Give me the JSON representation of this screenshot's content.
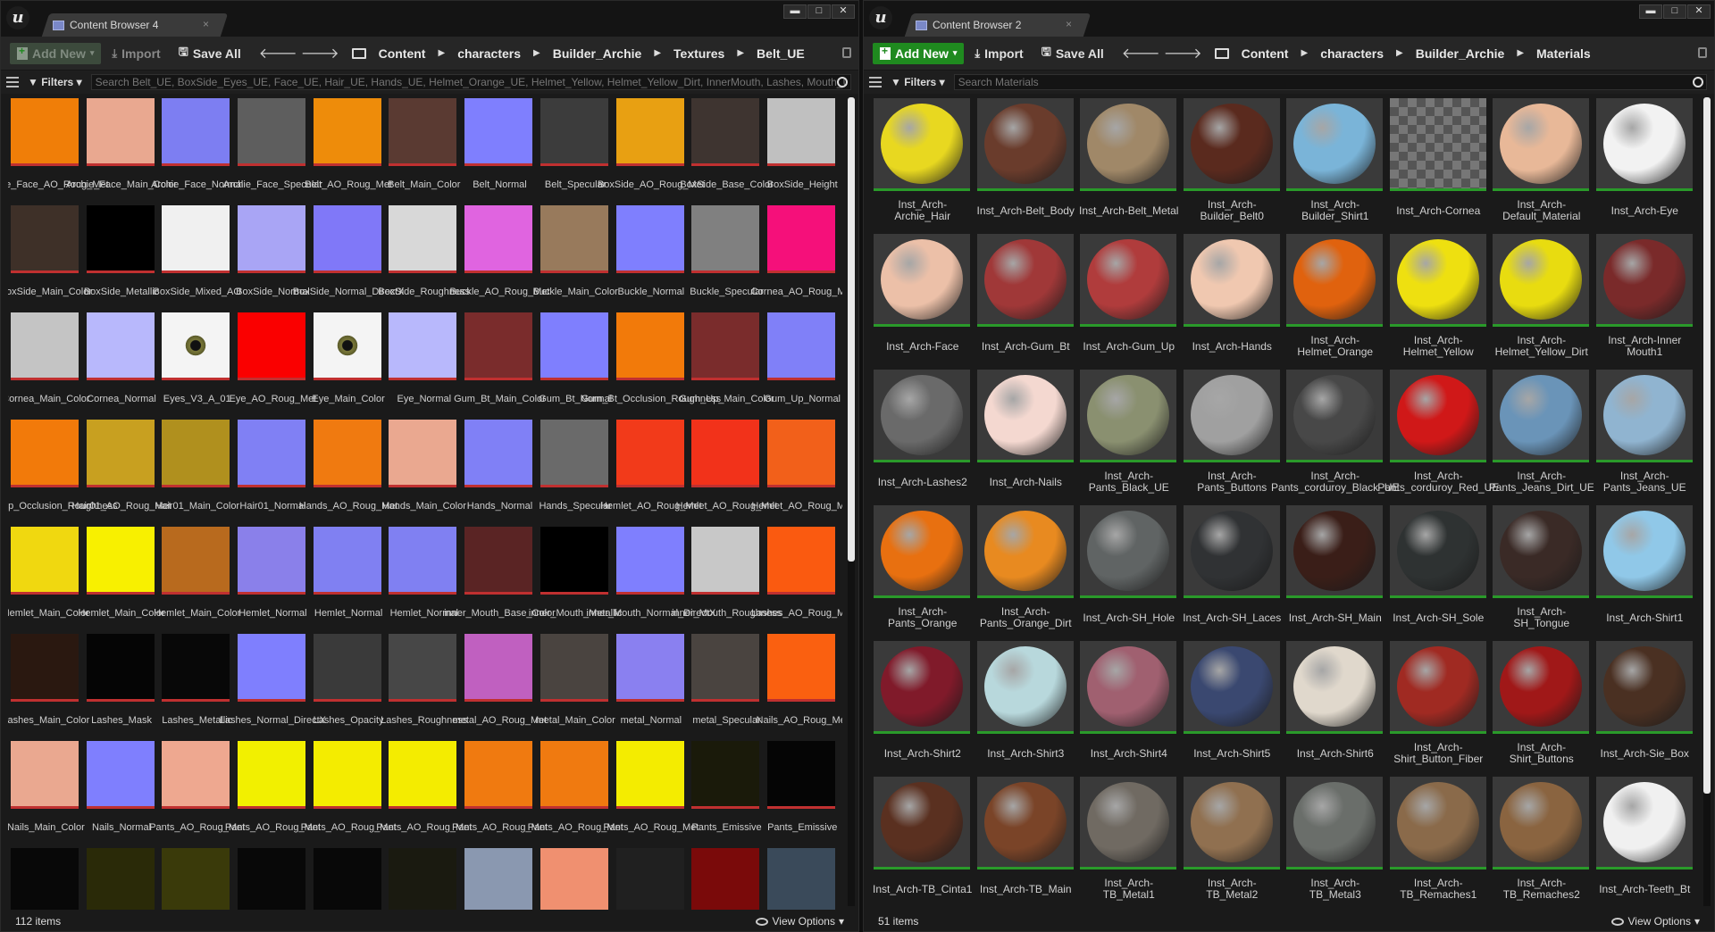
{
  "left": {
    "tab_title": "Content Browser 4",
    "toolbar": {
      "add_new": "Add New",
      "import": "Import",
      "save_all": "Save All"
    },
    "breadcrumb": [
      "Content",
      "characters",
      "Builder_Archie",
      "Textures",
      "Belt_UE"
    ],
    "filters_label": "Filters",
    "search_placeholder": "Search Belt_UE, BoxSide_Eyes_UE, Face_UE, Hair_UE, Hands_UE, Helmet_Orange_UE, Helmet_Yellow, Helmet_Yellow_Dirt, InnerMouth, Lashes, Mouth_UE",
    "item_count": "112 items",
    "view_options": "View Options",
    "assets": [
      {
        "label": "Archie_Face_AO_Roug_Met",
        "color": "#f07e08"
      },
      {
        "label": "Archie_Face_Main_Color",
        "color": "#e9a890"
      },
      {
        "label": "Archie_Face_Normal",
        "color": "#7d7ef2"
      },
      {
        "label": "Archie_Face_Specular",
        "color": "#5e5e5e"
      },
      {
        "label": "Belt_AO_Roug_Met",
        "color": "#ee8c0a"
      },
      {
        "label": "Belt_Main_Color",
        "color": "#5a3a32"
      },
      {
        "label": "Belt_Normal",
        "color": "#7f7ffe"
      },
      {
        "label": "Belt_Specular",
        "color": "#3c3c3c"
      },
      {
        "label": "BoxSide_AO_Roug_Met",
        "color": "#e8a012"
      },
      {
        "label": "BoxSide_Base_Color",
        "color": "#3e3430"
      },
      {
        "label": "BoxSide_Height",
        "color": "#c0c0c0"
      },
      {
        "label": "BoxSide_Main_Color",
        "color": "#3e3028"
      },
      {
        "label": "BoxSide_Metallic",
        "color": "#000000"
      },
      {
        "label": "BoxSide_Mixed_AO",
        "color": "#f0f0f0"
      },
      {
        "label": "BoxSide_Normal",
        "color": "#a9a5f5"
      },
      {
        "label": "BoxSide_Normal_DirectX",
        "color": "#8078f8"
      },
      {
        "label": "BoxSide_Roughness",
        "color": "#d8d8d8"
      },
      {
        "label": "Buckle_AO_Roug_Met",
        "color": "#e064e0"
      },
      {
        "label": "Buckle_Main_Color",
        "color": "#987a5c"
      },
      {
        "label": "Buckle_Normal",
        "color": "#7f7ffe"
      },
      {
        "label": "Buckle_Specular",
        "color": "#808080"
      },
      {
        "label": "Cornea_AO_Roug_Met",
        "color": "#f5107a"
      },
      {
        "label": "Cornea_Main_Color",
        "color": "#c4c4c4"
      },
      {
        "label": "Cornea_Normal",
        "color": "#b8b8fc"
      },
      {
        "label": "Eyes_V3_A_01",
        "color": "#f4f4f4",
        "eye": true
      },
      {
        "label": "Eye_AO_Roug_Met",
        "color": "#fa0000"
      },
      {
        "label": "Eye_Main_Color",
        "color": "#f4f4f4",
        "eye": true
      },
      {
        "label": "Eye_Normal",
        "color": "#b8b8fc"
      },
      {
        "label": "Gum_Bt_Main_Color",
        "color": "#7a2c2c"
      },
      {
        "label": "Gum_Bt_Normal",
        "color": "#7f7ffe"
      },
      {
        "label": "Gum_Bt_Occlusion_Roughness",
        "color": "#f27a0a"
      },
      {
        "label": "Gum_Up_Main_Color",
        "color": "#7a2c2c"
      },
      {
        "label": "Gum_Up_Normal",
        "color": "#8080f8"
      },
      {
        "label": "Gum_Up_Occlusion_Roughness",
        "color": "#f27a0a"
      },
      {
        "label": "Hair01_AO_Roug_Met",
        "color": "#c8a020"
      },
      {
        "label": "Hair01_Main_Color",
        "color": "#b0901e"
      },
      {
        "label": "Hair01_Normal",
        "color": "#8080f4"
      },
      {
        "label": "Hands_AO_Roug_Met",
        "color": "#f07a10"
      },
      {
        "label": "Hands_Main_Color",
        "color": "#eaa890"
      },
      {
        "label": "Hands_Normal",
        "color": "#8080f6"
      },
      {
        "label": "Hands_Specular",
        "color": "#6a6a6a"
      },
      {
        "label": "Hemlet_AO_Roug_Met",
        "color": "#f23a1a"
      },
      {
        "label": "Hemlet_AO_Roug_Met",
        "color": "#f2321a"
      },
      {
        "label": "Hemlet_AO_Roug_Met",
        "color": "#f2601a"
      },
      {
        "label": "Hemlet_Main_Color",
        "color": "#f0d810"
      },
      {
        "label": "Hemlet_Main_Color",
        "color": "#f8f000"
      },
      {
        "label": "Hemlet_Main_Color",
        "color": "#b86a1e"
      },
      {
        "label": "Hemlet_Normal",
        "color": "#8a80ea"
      },
      {
        "label": "Hemlet_Normal",
        "color": "#8080f2"
      },
      {
        "label": "Hemlet_Normal",
        "color": "#8080f2"
      },
      {
        "label": "inner_Mouth_Base_Color",
        "color": "#5a2424"
      },
      {
        "label": "inner_Mouth_Metallic",
        "color": "#000000"
      },
      {
        "label": "inner_Mouth_Normal_DirectX",
        "color": "#7f7ffe"
      },
      {
        "label": "inner_Mouth_Roughness",
        "color": "#c8c8c8"
      },
      {
        "label": "Lashes_AO_Roug_Met",
        "color": "#fa5a10"
      },
      {
        "label": "Lashes_Main_Color",
        "color": "#2a1810"
      },
      {
        "label": "Lashes_Mask",
        "color": "#050505"
      },
      {
        "label": "Lashes_Metallic",
        "color": "#080808"
      },
      {
        "label": "Lashes_Normal_DirectX",
        "color": "#7f7ffe"
      },
      {
        "label": "Lashes_Opacity",
        "color": "#3a3a3a"
      },
      {
        "label": "Lashes_Roughness",
        "color": "#474747"
      },
      {
        "label": "metal_AO_Roug_Met",
        "color": "#c060c0"
      },
      {
        "label": "metal_Main_Color",
        "color": "#4a4440"
      },
      {
        "label": "metal_Normal",
        "color": "#8a80f0"
      },
      {
        "label": "metal_Specular",
        "color": "#4a4440"
      },
      {
        "label": "Nails_AO_Roug_Met",
        "color": "#fa6010"
      },
      {
        "label": "Nails_Main_Color",
        "color": "#eaa890"
      },
      {
        "label": "Nails_Normal",
        "color": "#7f7ffe"
      },
      {
        "label": "Pants_AO_Roug_Met",
        "color": "#eea890"
      },
      {
        "label": "Pants_AO_Roug_Met",
        "color": "#f2f000"
      },
      {
        "label": "Pants_AO_Roug_Met",
        "color": "#f4ec00"
      },
      {
        "label": "Pants_AO_Roug_Met",
        "color": "#f4ec00"
      },
      {
        "label": "Pants_AO_Roug_Met",
        "color": "#f07a10"
      },
      {
        "label": "Pants_AO_Roug_Met",
        "color": "#f07a10"
      },
      {
        "label": "Pants_AO_Roug_Met",
        "color": "#f4ec00"
      },
      {
        "label": "Pants_Emissive",
        "color": "#1a1a0a"
      },
      {
        "label": "Pants_Emissive",
        "color": "#050505"
      },
      {
        "label": "",
        "color": "#080808"
      },
      {
        "label": "",
        "color": "#2a2a08"
      },
      {
        "label": "",
        "color": "#3a3a0a"
      },
      {
        "label": "",
        "color": "#080808"
      },
      {
        "label": "",
        "color": "#080808"
      },
      {
        "label": "",
        "color": "#1a1a10"
      },
      {
        "label": "",
        "color": "#8a98b0"
      },
      {
        "label": "",
        "color": "#f09070"
      },
      {
        "label": "",
        "color": "#202020"
      },
      {
        "label": "",
        "color": "#7a0a0a"
      },
      {
        "label": "",
        "color": "#3a4a5a"
      }
    ]
  },
  "right": {
    "tab_title": "Content Browser 2",
    "toolbar": {
      "add_new": "Add New",
      "import": "Import",
      "save_all": "Save All"
    },
    "breadcrumb": [
      "Content",
      "characters",
      "Builder_Archie",
      "Materials"
    ],
    "filters_label": "Filters",
    "search_placeholder": "Search Materials",
    "item_count": "51 items",
    "view_options": "View Options",
    "materials": [
      {
        "label": "Inst_Arch-Archie_Hair",
        "color": "#e8d820"
      },
      {
        "label": "Inst_Arch-Belt_Body",
        "color": "#6a3c2c"
      },
      {
        "label": "Inst_Arch-Belt_Metal",
        "color": "#a08868"
      },
      {
        "label": "Inst_Arch-Builder_Belt0",
        "color": "#5a2a1e"
      },
      {
        "label": "Inst_Arch-Builder_Shirt1",
        "color": "#7ab4d8"
      },
      {
        "label": "Inst_Arch-Cornea",
        "color": "",
        "checker": true
      },
      {
        "label": "Inst_Arch-Default_Material",
        "color": "#e8b898"
      },
      {
        "label": "Inst_Arch-Eye",
        "color": "#f2f2f2"
      },
      {
        "label": "Inst_Arch-Face",
        "color": "#ecc0a8"
      },
      {
        "label": "Inst_Arch-Gum_Bt",
        "color": "#a03838"
      },
      {
        "label": "Inst_Arch-Gum_Up",
        "color": "#b03c3c"
      },
      {
        "label": "Inst_Arch-Hands",
        "color": "#f0c8b0"
      },
      {
        "label": "Inst_Arch-Helmet_Orange",
        "color": "#e0620e"
      },
      {
        "label": "Inst_Arch-Helmet_Yellow",
        "color": "#eee010"
      },
      {
        "label": "Inst_Arch-Helmet_Yellow_Dirt",
        "color": "#e8dc10"
      },
      {
        "label": "Inst_Arch-Inner Mouth1",
        "color": "#7a2a2a"
      },
      {
        "label": "Inst_Arch-Lashes2",
        "color": "#6a6a6a"
      },
      {
        "label": "Inst_Arch-Nails",
        "color": "#f4d8d0"
      },
      {
        "label": "Inst_Arch-Pants_Black_UE",
        "color": "#8a9070"
      },
      {
        "label": "Inst_Arch-Pants_Buttons",
        "color": "#a0a0a0"
      },
      {
        "label": "Inst_Arch-Pants_corduroy_Black_UE",
        "color": "#484848"
      },
      {
        "label": "Inst_Arch-Pants_corduroy_Red_UE",
        "color": "#d01818"
      },
      {
        "label": "Inst_Arch-Pants_Jeans_Dirt_UE",
        "color": "#6a94b8"
      },
      {
        "label": "Inst_Arch-Pants_Jeans_UE",
        "color": "#90b4d0"
      },
      {
        "label": "Inst_Arch-Pants_Orange",
        "color": "#e87010"
      },
      {
        "label": "Inst_Arch-Pants_Orange_Dirt",
        "color": "#e88a20"
      },
      {
        "label": "Inst_Arch-SH_Hole",
        "color": "#606464"
      },
      {
        "label": "Inst_Arch-SH_Laces",
        "color": "#303234"
      },
      {
        "label": "Inst_Arch-SH_Main",
        "color": "#3a1e18"
      },
      {
        "label": "Inst_Arch-SH_Sole",
        "color": "#2e3232"
      },
      {
        "label": "Inst_Arch-SH_Tongue",
        "color": "#3a2a26"
      },
      {
        "label": "Inst_Arch-Shirt1",
        "color": "#90c8e8"
      },
      {
        "label": "Inst_Arch-Shirt2",
        "color": "#801a2a"
      },
      {
        "label": "Inst_Arch-Shirt3",
        "color": "#b8d8dc"
      },
      {
        "label": "Inst_Arch-Shirt4",
        "color": "#a06070"
      },
      {
        "label": "Inst_Arch-Shirt5",
        "color": "#3a4870"
      },
      {
        "label": "Inst_Arch-Shirt6",
        "color": "#e0d8cc"
      },
      {
        "label": "Inst_Arch-Shirt_Button_Fiber",
        "color": "#a02a22"
      },
      {
        "label": "Inst_Arch-Shirt_Buttons",
        "color": "#a01818"
      },
      {
        "label": "Inst_Arch-Sie_Box",
        "color": "#4a3022"
      },
      {
        "label": "Inst_Arch-TB_Cinta1",
        "color": "#5a3020"
      },
      {
        "label": "Inst_Arch-TB_Main",
        "color": "#7a4428"
      },
      {
        "label": "Inst_Arch-TB_Metal1",
        "color": "#706a62"
      },
      {
        "label": "Inst_Arch-TB_Metal2",
        "color": "#907050"
      },
      {
        "label": "Inst_Arch-TB_Metal3",
        "color": "#6a6e6a"
      },
      {
        "label": "Inst_Arch-TB_Remaches1",
        "color": "#8a6a4a"
      },
      {
        "label": "Inst_Arch-TB_Remaches2",
        "color": "#8a6440"
      },
      {
        "label": "Inst_Arch-Teeth_Bt",
        "color": "#f0f0f0"
      }
    ]
  }
}
